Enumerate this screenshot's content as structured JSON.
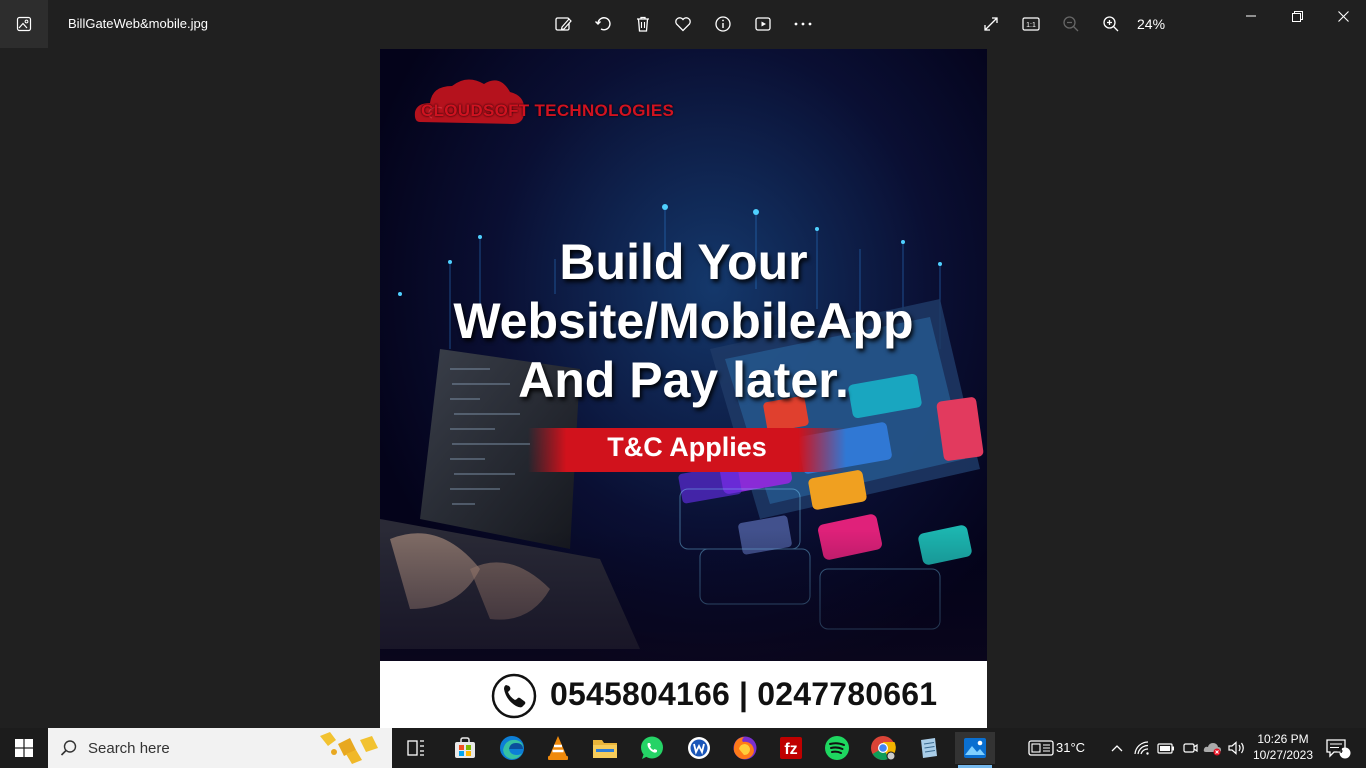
{
  "titlebar": {
    "filename": "BillGateWeb&mobile.jpg",
    "zoom_level": "24%",
    "toolbar_icons": [
      "edit-image-icon",
      "rotate-icon",
      "delete-icon",
      "favorite-icon",
      "info-icon",
      "slideshow-icon",
      "more-icon"
    ],
    "view_icons": [
      "full-screen-icon",
      "actual-size-icon",
      "zoom-out-icon",
      "zoom-in-icon"
    ]
  },
  "poster": {
    "logo_text": "CLOUDSOFT TECHNOLOGIES",
    "headline_line1": "Build Your",
    "headline_line2": "Website/MobileApp",
    "headline_line3": "And Pay later.",
    "tc_label": "T&C Applies",
    "phone_numbers": "0545804166 | 0247780661",
    "colors": {
      "brand_red": "#d1121c",
      "background": "#06051a"
    }
  },
  "taskbar": {
    "search_placeholder": "Search here",
    "pinned_apps": [
      "task-view",
      "microsoft-store",
      "edge",
      "vlc",
      "file-explorer",
      "whatsapp",
      "app-w",
      "firefox",
      "filezilla",
      "spotify",
      "chrome",
      "notepad",
      "photos"
    ],
    "weather_temp": "31°C",
    "clock_time": "10:26 PM",
    "clock_date": "10/27/2023",
    "notification_count": "4",
    "accent_color": "#76b9ed"
  }
}
